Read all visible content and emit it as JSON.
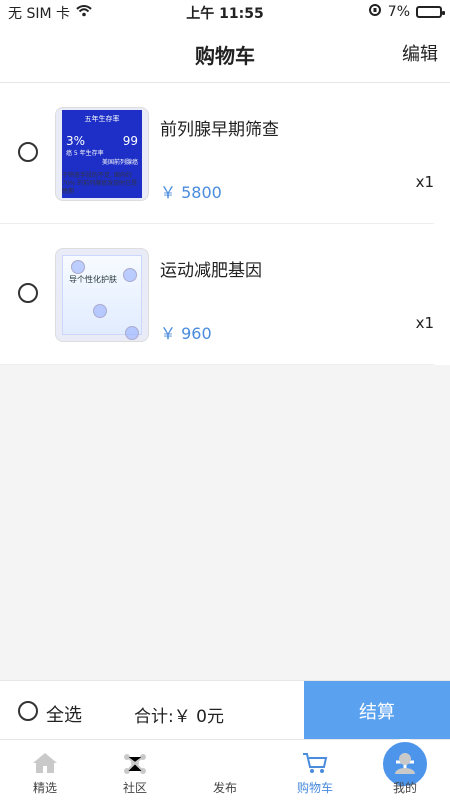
{
  "status": {
    "carrier": "无 SIM 卡",
    "time": "上午 11:55",
    "battery": "7%"
  },
  "header": {
    "title": "购物车",
    "edit": "编辑"
  },
  "items": [
    {
      "name": "前列腺早期筛查",
      "price": "￥ 5800",
      "qty": "x1",
      "thumb": {
        "title": "五年生存率",
        "n1": "3%",
        "n2": "99",
        "sub_left": "癌 5 年生存率",
        "sub_right": "美国前列腺癌",
        "caption": "于筛查手段的不足, 国内约70% 的前列腺癌发现时已是晚期"
      }
    },
    {
      "name": "运动减肥基因",
      "price": "￥ 960",
      "qty": "x1",
      "thumb": {
        "title": "导个性化护肤"
      }
    }
  ],
  "footer": {
    "select_all": "全选",
    "total": "合计:￥ 0元",
    "checkout": "结算"
  },
  "tabs": [
    {
      "label": "精选"
    },
    {
      "label": "社区"
    },
    {
      "label": "发布"
    },
    {
      "label": "购物车"
    },
    {
      "label": "我的"
    }
  ],
  "colors": {
    "accent": "#4a8bdc",
    "checkout_bg": "#5aa1ef",
    "thumb_band": "#1d2fc6"
  }
}
